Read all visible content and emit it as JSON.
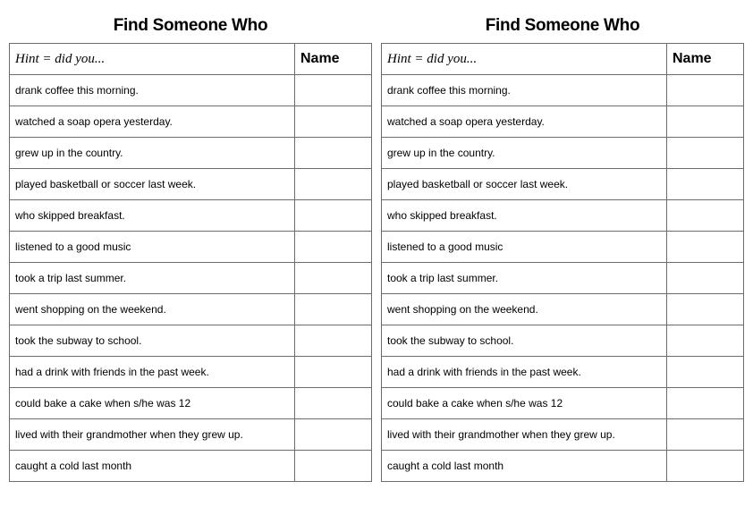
{
  "title": "Find Someone Who",
  "hint_label": "Hint = did you...",
  "name_label": "Name",
  "prompts": [
    "drank coffee this morning.",
    "watched a soap opera yesterday.",
    "grew up in the country.",
    "played basketball or soccer last week.",
    "who skipped breakfast.",
    "listened to a good music",
    "took a trip last summer.",
    "went shopping on the weekend.",
    "took the subway to school.",
    "had a drink with friends in the past week.",
    "could bake a cake when s/he was 12",
    "lived with their grandmother when they grew up.",
    "caught a cold last month"
  ]
}
